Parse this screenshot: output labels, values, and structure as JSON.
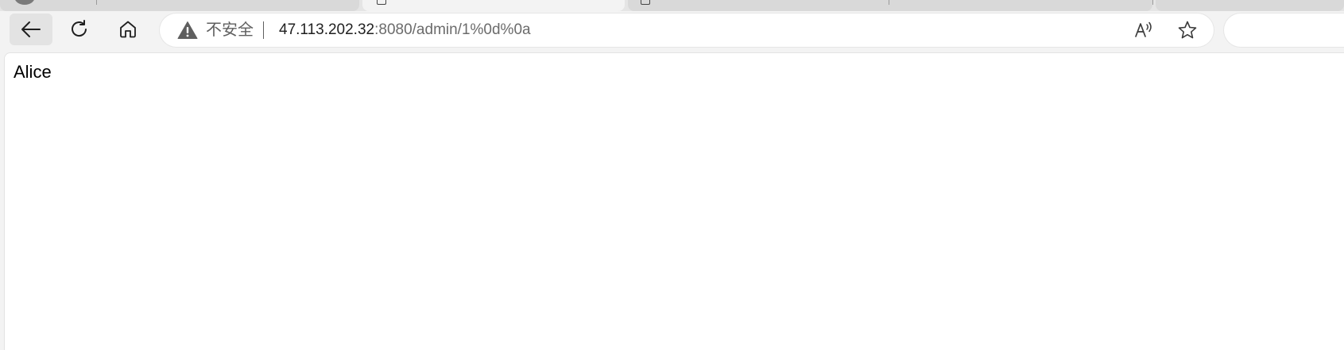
{
  "tabs": [
    {
      "label": "",
      "active": false
    },
    {
      "label": "",
      "active": true
    },
    {
      "label": "",
      "active": false
    },
    {
      "label": "",
      "active": false
    }
  ],
  "toolbar": {
    "back_icon": "arrow-left-icon",
    "reload_icon": "reload-icon",
    "home_icon": "home-icon"
  },
  "address_bar": {
    "security_icon": "warning-triangle-icon",
    "security_label": "不安全",
    "url_host": "47.113.202.32",
    "url_rest": ":8080/admin/1%0d%0a",
    "read_aloud_icon": "read-aloud-icon",
    "favorite_icon": "star-icon"
  },
  "page": {
    "body_text": "Alice"
  },
  "colors": {
    "chrome_bg": "#f3f3f3",
    "tab_bg": "#d9d9d9",
    "omnibox_bg": "#ffffff",
    "warning_icon": "#5f5f5f",
    "url_host": "#1f1f1f",
    "url_rest": "#6b6b6b"
  }
}
